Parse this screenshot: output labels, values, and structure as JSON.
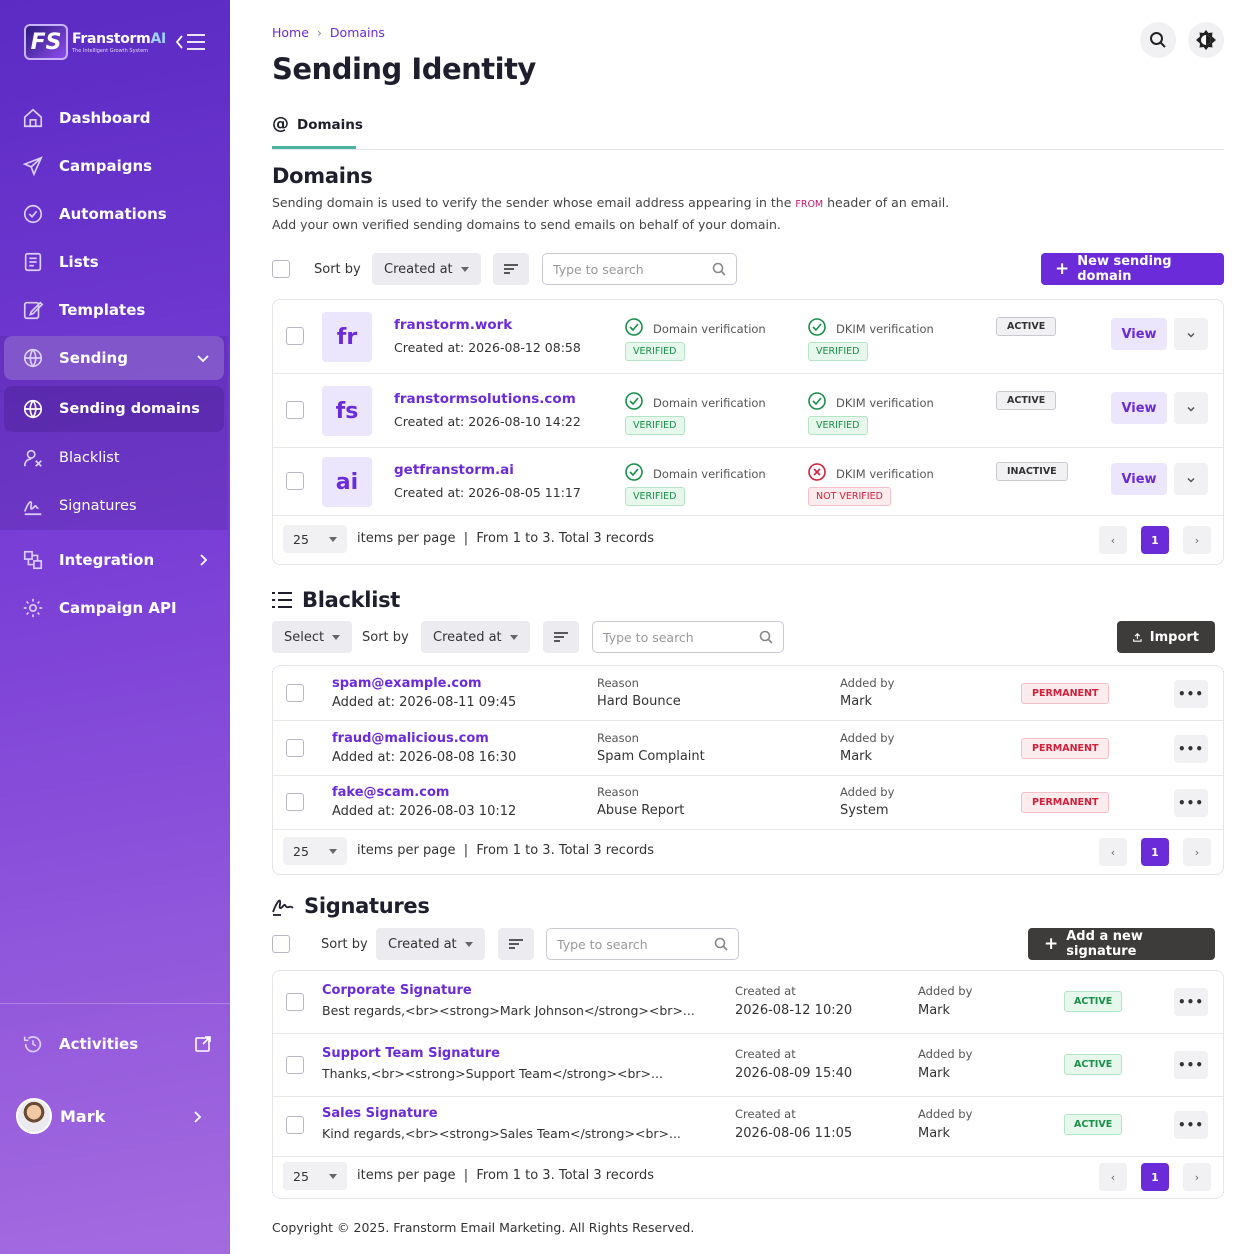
{
  "brand": {
    "logo_letters": "FS",
    "name": "Franstorm",
    "name_suffix": "AI",
    "tagline": "The Intelligent Growth System"
  },
  "sidebar": {
    "items": [
      {
        "label": "Dashboard"
      },
      {
        "label": "Campaigns"
      },
      {
        "label": "Automations"
      },
      {
        "label": "Lists"
      },
      {
        "label": "Templates"
      },
      {
        "label": "Sending"
      },
      {
        "label": "Sending domains"
      },
      {
        "label": "Blacklist"
      },
      {
        "label": "Signatures"
      },
      {
        "label": "Integration"
      },
      {
        "label": "Campaign API"
      }
    ],
    "activities": "Activities",
    "user_name": "Mark"
  },
  "breadcrumb": {
    "home": "Home",
    "sep": "›",
    "current": "Domains"
  },
  "page_title": "Sending Identity",
  "tab": {
    "label": "Domains"
  },
  "domains": {
    "title": "Domains",
    "desc_pre": "Sending domain is used to verify the sender whose email address appearing in the",
    "desc_from": "FROM",
    "desc_post": "header of an email.",
    "desc_line2": "Add your own verified sending domains to send emails on behalf of your domain.",
    "sort_by": "Sort by",
    "sort_value": "Created at",
    "search_placeholder": "Type to search",
    "new_button": "New sending domain",
    "domain_verification": "Domain verification",
    "dkim_verification": "DKIM verification",
    "view": "View",
    "rows": [
      {
        "abbr": "fr",
        "name": "franstorm.work",
        "created": "Created at: 2026-08-12 08:58",
        "domain_status": "VERIFIED",
        "dkim_status": "VERIFIED",
        "dkim_ok": true,
        "state": "ACTIVE"
      },
      {
        "abbr": "fs",
        "name": "franstormsolutions.com",
        "created": "Created at: 2026-08-10 14:22",
        "domain_status": "VERIFIED",
        "dkim_status": "VERIFIED",
        "dkim_ok": true,
        "state": "ACTIVE"
      },
      {
        "abbr": "ai",
        "name": "getfranstorm.ai",
        "created": "Created at: 2026-08-05 11:17",
        "domain_status": "VERIFIED",
        "dkim_status": "NOT VERIFIED",
        "dkim_ok": false,
        "state": "INACTIVE"
      }
    ],
    "pager": {
      "per_page": "25",
      "text": "items per page  |  From 1 to 3. Total 3 records",
      "page": "1"
    }
  },
  "blacklist": {
    "title": "Blacklist",
    "select": "Select",
    "sort_by": "Sort by",
    "sort_value": "Created at",
    "search_placeholder": "Type to search",
    "import": "Import",
    "reason_label": "Reason",
    "added_by_label": "Added by",
    "more": "•••",
    "rows": [
      {
        "email": "spam@example.com",
        "added": "Added at: 2026-08-11 09:45",
        "reason": "Hard Bounce",
        "by": "Mark",
        "badge": "PERMANENT"
      },
      {
        "email": "fraud@malicious.com",
        "added": "Added at: 2026-08-08 16:30",
        "reason": "Spam Complaint",
        "by": "Mark",
        "badge": "PERMANENT"
      },
      {
        "email": "fake@scam.com",
        "added": "Added at: 2026-08-03 10:12",
        "reason": "Abuse Report",
        "by": "System",
        "badge": "PERMANENT"
      }
    ],
    "pager": {
      "per_page": "25",
      "text": "items per page  |  From 1 to 3. Total 3 records",
      "page": "1"
    }
  },
  "signatures": {
    "title": "Signatures",
    "sort_by": "Sort by",
    "sort_value": "Created at",
    "search_placeholder": "Type to search",
    "add": "Add a new signature",
    "created_label": "Created at",
    "added_by_label": "Added by",
    "more": "•••",
    "rows": [
      {
        "name": "Corporate Signature",
        "preview": "Best regards,<br><strong>Mark Johnson</strong><br>...",
        "created": "2026-08-12 10:20",
        "by": "Mark",
        "badge": "ACTIVE"
      },
      {
        "name": "Support Team Signature",
        "preview": "Thanks,<br><strong>Support Team</strong><br>...",
        "created": "2026-08-09 15:40",
        "by": "Mark",
        "badge": "ACTIVE"
      },
      {
        "name": "Sales Signature",
        "preview": "Kind regards,<br><strong>Sales Team</strong><br>...",
        "created": "2026-08-06 11:05",
        "by": "Mark",
        "badge": "ACTIVE"
      }
    ],
    "pager": {
      "per_page": "25",
      "text": "items per page  |  From 1 to 3. Total 3 records",
      "page": "1"
    }
  },
  "footer": "Copyright © 2025. Franstorm Email Marketing. All Rights Reserved.",
  "colors": {
    "accent": "#6b2bd8",
    "success": "#1a8f4a",
    "danger": "#d3203a",
    "tab_underline": "#4ab4a0",
    "dark_button": "#3e3b3b"
  },
  "icons": {
    "search": "search-icon",
    "theme": "brightness-icon",
    "menu": "menu-collapse-icon"
  }
}
